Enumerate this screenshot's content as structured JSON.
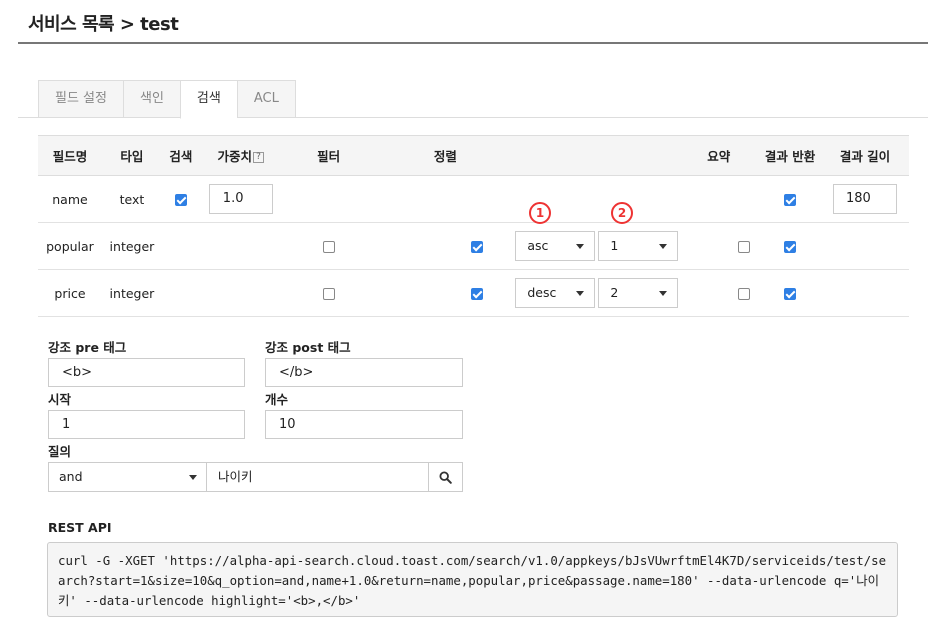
{
  "page": {
    "title": "서비스 목록 > test"
  },
  "tabs": [
    {
      "label": "필드 설정",
      "active": false
    },
    {
      "label": "색인",
      "active": false
    },
    {
      "label": "검색",
      "active": true
    },
    {
      "label": "ACL",
      "active": false
    }
  ],
  "table": {
    "headers": {
      "field": "필드명",
      "type": "타입",
      "search": "검색",
      "weight": "가중치",
      "weight_help": "?",
      "filter": "필터",
      "sort": "정렬",
      "summary": "요약",
      "return": "결과 반환",
      "length": "결과 길이"
    },
    "rows": [
      {
        "name": "name",
        "type": "text",
        "search": true,
        "weight": "1.0",
        "filter": null,
        "sort": null,
        "sort_order": null,
        "sort_priority": null,
        "summary": null,
        "return": true,
        "length": "180"
      },
      {
        "name": "popular",
        "type": "integer",
        "search": null,
        "weight": null,
        "filter": false,
        "sort": true,
        "sort_order": "asc",
        "sort_priority": "1",
        "summary": false,
        "return": true,
        "length": null
      },
      {
        "name": "price",
        "type": "integer",
        "search": null,
        "weight": null,
        "filter": false,
        "sort": true,
        "sort_order": "desc",
        "sort_priority": "2",
        "summary": false,
        "return": true,
        "length": null
      }
    ],
    "annotations": [
      "1",
      "2"
    ]
  },
  "form": {
    "pre_tag_label": "강조 pre 태그",
    "pre_tag_value": "<b>",
    "post_tag_label": "강조 post 태그",
    "post_tag_value": "</b>",
    "start_label": "시작",
    "start_value": "1",
    "count_label": "개수",
    "count_value": "10",
    "query_label": "질의",
    "query_option": "and",
    "query_text": "나이키"
  },
  "rest_api": {
    "label": "REST API",
    "command": "curl -G -XGET 'https://alpha-api-search.cloud.toast.com/search/v1.0/appkeys/bJsVUwrftmEl4K7D/serviceids/test/search?start=1&size=10&q_option=and,name+1.0&return=name,popular,price&passage.name=180' --data-urlencode q='나이키' --data-urlencode highlight='<b>,</b>'"
  },
  "colors": {
    "accent": "#2e7fe4",
    "annotation": "#ee3333"
  }
}
